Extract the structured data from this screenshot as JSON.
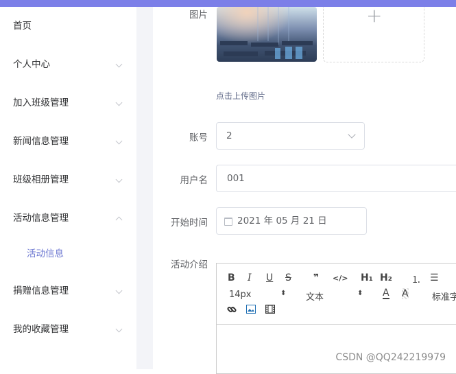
{
  "sidebar": {
    "items": [
      {
        "label": "首页"
      },
      {
        "label": "个人中心"
      },
      {
        "label": "加入班级管理"
      },
      {
        "label": "新闻信息管理"
      },
      {
        "label": "班级相册管理"
      },
      {
        "label": "活动信息管理"
      },
      {
        "label": "捐赠信息管理"
      },
      {
        "label": "我的收藏管理"
      }
    ],
    "subitem": {
      "label": "活动信息"
    }
  },
  "form": {
    "image_label": "图片",
    "upload_tip": "点击上传图片",
    "plus": "+",
    "account": {
      "label": "账号",
      "value": "2"
    },
    "username": {
      "label": "用户名",
      "value": "001"
    },
    "start_time": {
      "label": "开始时间",
      "value": "2021 年 05 月 21 日"
    },
    "intro": {
      "label": "活动介绍"
    }
  },
  "editor": {
    "bold": "B",
    "italic": "I",
    "underline": "U",
    "strike": "S",
    "quote": "❞",
    "code": "</>",
    "h1": "H₁",
    "h2": "H₂",
    "ordered": "⒈",
    "bullet": "☰",
    "size": "14px",
    "font": "文本",
    "color_a": "A",
    "bg_a": "A",
    "partial": "标准字"
  },
  "watermark": "CSDN @QQ242219979"
}
